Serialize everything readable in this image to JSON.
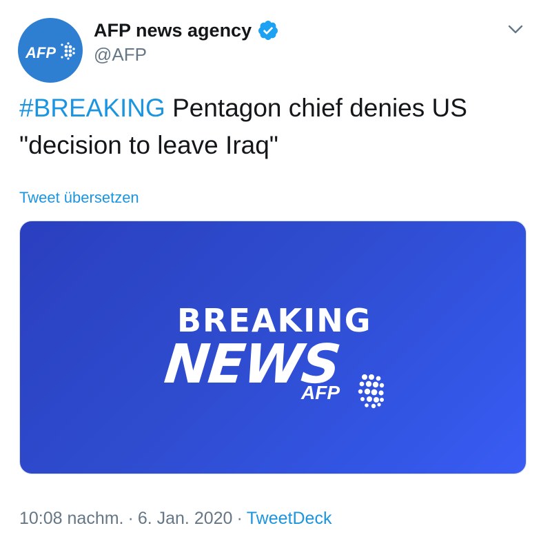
{
  "author": {
    "display_name": "AFP news agency",
    "handle": "@AFP",
    "verified": true,
    "avatar_logo_text": "AFP"
  },
  "tweet": {
    "hashtag": "#BREAKING",
    "text": "Pentagon chief denies US \"decision to leave Iraq\""
  },
  "actions": {
    "translate_label": "Tweet übersetzen",
    "menu_icon": "chevron-down-icon"
  },
  "media": {
    "line1": "BREAKING",
    "line2": "NEWS",
    "logo_text": "AFP"
  },
  "meta": {
    "time": "10:08 nachm.",
    "separator": "·",
    "date": "6. Jan. 2020",
    "source": "TweetDeck"
  },
  "colors": {
    "link": "#1b95e0",
    "avatar_bg": "#2e7fd1",
    "media_bg": "#2f4ccf",
    "muted": "#657786",
    "verified": "#1da1f2"
  }
}
